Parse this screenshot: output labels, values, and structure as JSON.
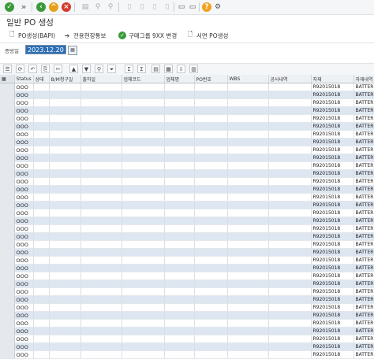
{
  "toolbar": {
    "icons": [
      "check-icon",
      "double-chevron-icon",
      "back-icon",
      "exit-icon",
      "cancel-icon",
      "print-icon",
      "find-icon",
      "find-next-icon",
      "first-page-icon",
      "prev-page-icon",
      "next-page-icon",
      "last-page-icon",
      "new-session-icon",
      "shortcut-icon",
      "help-icon",
      "settings-icon"
    ]
  },
  "title": "일반 PO 생성",
  "app_toolbar": {
    "buttons": [
      {
        "label": "PO생성(BAPI)",
        "icon": "document-icon"
      },
      {
        "label": "전용현장통보",
        "icon": "arrow-right-icon"
      },
      {
        "label": "구매그룹 9XX 변경",
        "icon": "check-circle-icon"
      },
      {
        "label": "서면 PO생성",
        "icon": "document-icon"
      }
    ]
  },
  "field": {
    "label": "증빙일",
    "value": "2023.12.20"
  },
  "grid": {
    "headers": [
      "",
      "Status",
      "상태",
      "B/M청구일",
      "출하일",
      "업체코드",
      "업체명",
      "PO번호",
      "WBS",
      "공사내역",
      "자재",
      "자재내역"
    ],
    "rows": [
      [
        "",
        "OOO",
        "",
        "",
        "",
        "",
        "",
        "",
        "",
        "",
        "R92015018",
        "BATTER"
      ],
      [
        "",
        "OOO",
        "",
        "",
        "",
        "",
        "",
        "",
        "",
        "",
        "R92015018",
        "BATTER"
      ],
      [
        "",
        "OOO",
        "",
        "",
        "",
        "",
        "",
        "",
        "",
        "",
        "R92015018",
        "BATTER"
      ],
      [
        "",
        "OOO",
        "",
        "",
        "",
        "",
        "",
        "",
        "",
        "",
        "R92015018",
        "BATTER"
      ],
      [
        "",
        "OOO",
        "",
        "",
        "",
        "",
        "",
        "",
        "",
        "",
        "R92015018",
        "BATTER"
      ],
      [
        "",
        "OOO",
        "",
        "",
        "",
        "",
        "",
        "",
        "",
        "",
        "R92015018",
        "BATTER"
      ],
      [
        "",
        "OOO",
        "",
        "",
        "",
        "",
        "",
        "",
        "",
        "",
        "R92015018",
        "BATTER"
      ],
      [
        "",
        "OOO",
        "",
        "",
        "",
        "",
        "",
        "",
        "",
        "",
        "R92015018",
        "BATTER"
      ],
      [
        "",
        "OOO",
        "",
        "",
        "",
        "",
        "",
        "",
        "",
        "",
        "R92015018",
        "BATTER"
      ],
      [
        "",
        "OOO",
        "",
        "",
        "",
        "",
        "",
        "",
        "",
        "",
        "R92015018",
        "BATTER"
      ],
      [
        "",
        "OOO",
        "",
        "",
        "",
        "",
        "",
        "",
        "",
        "",
        "R92015018",
        "BATTER"
      ],
      [
        "",
        "OOO",
        "",
        "",
        "",
        "",
        "",
        "",
        "",
        "",
        "R92015018",
        "BATTER"
      ],
      [
        "",
        "OOO",
        "",
        "",
        "",
        "",
        "",
        "",
        "",
        "",
        "R92015018",
        "BATTER"
      ],
      [
        "",
        "OOO",
        "",
        "",
        "",
        "",
        "",
        "",
        "",
        "",
        "R92015018",
        "BATTER"
      ],
      [
        "",
        "OOO",
        "",
        "",
        "",
        "",
        "",
        "",
        "",
        "",
        "R92015018",
        "BATTER"
      ],
      [
        "",
        "OOO",
        "",
        "",
        "",
        "",
        "",
        "",
        "",
        "",
        "R92015018",
        "BATTER"
      ],
      [
        "",
        "OOO",
        "",
        "",
        "",
        "",
        "",
        "",
        "",
        "",
        "R92015018",
        "BATTER"
      ],
      [
        "",
        "OOO",
        "",
        "",
        "",
        "",
        "",
        "",
        "",
        "",
        "R92015018",
        "BATTER"
      ],
      [
        "",
        "OOO",
        "",
        "",
        "",
        "",
        "",
        "",
        "",
        "",
        "R92015018",
        "BATTER"
      ],
      [
        "",
        "OOO",
        "",
        "",
        "",
        "",
        "",
        "",
        "",
        "",
        "R92015018",
        "BATTER"
      ],
      [
        "",
        "OOO",
        "",
        "",
        "",
        "",
        "",
        "",
        "",
        "",
        "R92015018",
        "BATTER"
      ],
      [
        "",
        "OOO",
        "",
        "",
        "",
        "",
        "",
        "",
        "",
        "",
        "R92015018",
        "BATTER"
      ],
      [
        "",
        "OOO",
        "",
        "",
        "",
        "",
        "",
        "",
        "",
        "",
        "R92015018",
        "BATTER"
      ],
      [
        "",
        "OOO",
        "",
        "",
        "",
        "",
        "",
        "",
        "",
        "",
        "R92015018",
        "BATTER"
      ],
      [
        "",
        "OOO",
        "",
        "",
        "",
        "",
        "",
        "",
        "",
        "",
        "R92015018",
        "BATTER"
      ],
      [
        "",
        "OOO",
        "",
        "",
        "",
        "",
        "",
        "",
        "",
        "",
        "R92015018",
        "BATTER"
      ],
      [
        "",
        "OOO",
        "",
        "",
        "",
        "",
        "",
        "",
        "",
        "",
        "R92015018",
        "BATTER"
      ],
      [
        "",
        "OOO",
        "",
        "",
        "",
        "",
        "",
        "",
        "",
        "",
        "R92015018",
        "BATTER"
      ],
      [
        "",
        "OOO",
        "",
        "",
        "",
        "",
        "",
        "",
        "",
        "",
        "R92015018",
        "BATTER"
      ],
      [
        "",
        "OOO",
        "",
        "",
        "",
        "",
        "",
        "",
        "",
        "",
        "R92015018",
        "BATTER"
      ],
      [
        "",
        "OOO",
        "",
        "",
        "",
        "",
        "",
        "",
        "",
        "",
        "R92015018",
        "BATTER"
      ],
      [
        "",
        "OOO",
        "",
        "",
        "",
        "",
        "",
        "",
        "",
        "",
        "R92015018",
        "BATTER"
      ],
      [
        "",
        "OOO",
        "",
        "",
        "",
        "",
        "",
        "",
        "",
        "",
        "R92015018",
        "BATTER"
      ],
      [
        "",
        "OOO",
        "",
        "",
        "",
        "",
        "",
        "",
        "",
        "",
        "R92015018",
        "BATTER"
      ],
      [
        "",
        "OOO",
        "",
        "",
        "",
        "",
        "",
        "",
        "",
        "",
        "R92015018",
        "BATTER"
      ]
    ]
  },
  "colors": {
    "selected_field": "#2d6fb6",
    "row_alt": "#dde6f1",
    "toolbar_bg": "#f4f6f8"
  }
}
